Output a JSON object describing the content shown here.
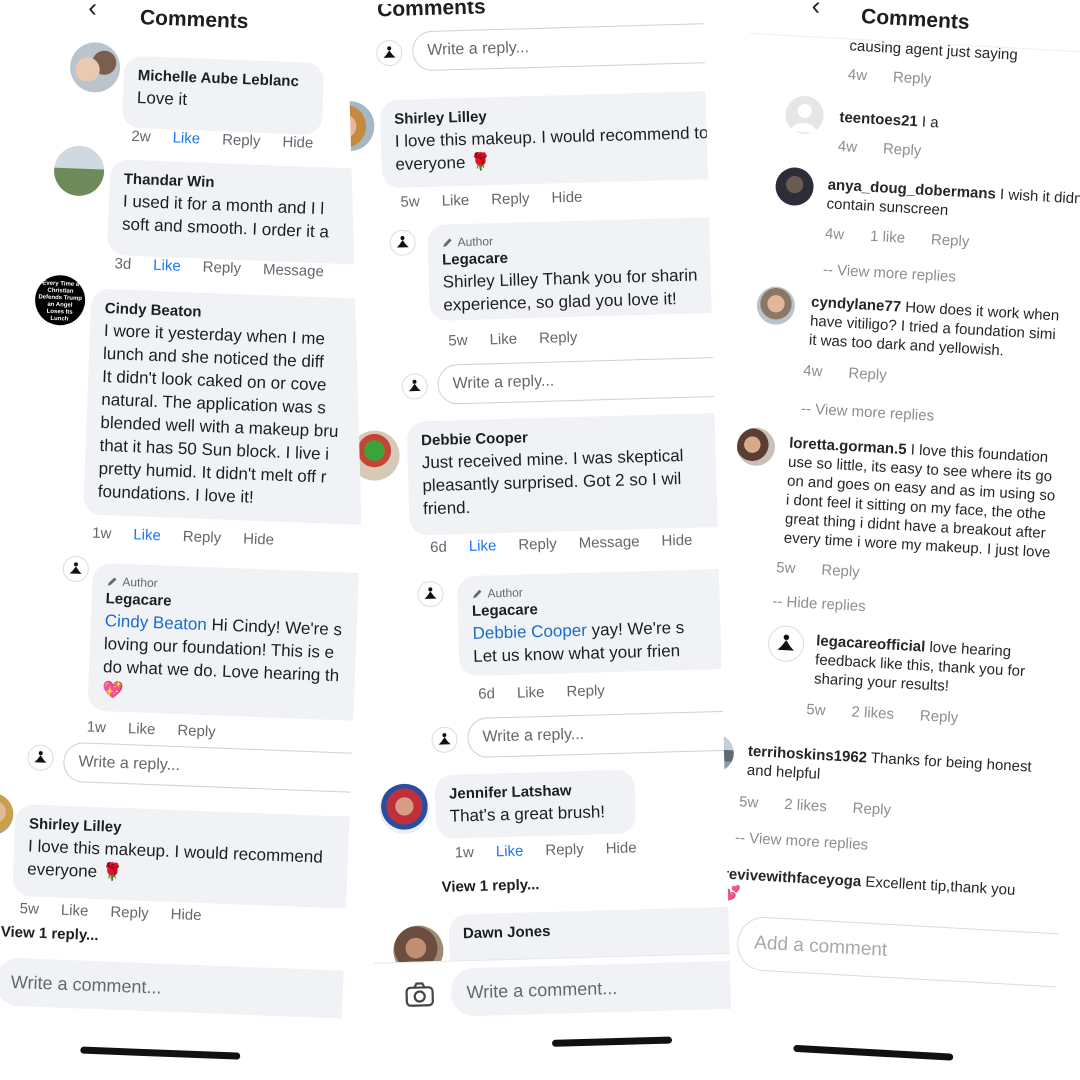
{
  "colors": {
    "like_active": "#1877f2",
    "mention": "#1a6ec8",
    "bubble": "#f0f2f5",
    "meta": "#65676b"
  },
  "icons": {
    "back": "chevron-left-icon",
    "meditation": "meditation-logo-icon",
    "camera": "camera-icon",
    "pencil": "pencil-icon",
    "rose": "rose-emoji",
    "heart": "heart-emoji"
  },
  "p1": {
    "title": "Comments",
    "c1": {
      "name": "Michelle Aube Leblanc",
      "text": "Love it",
      "actions": [
        "2w",
        "Like",
        "Reply",
        "Hide"
      ]
    },
    "c2": {
      "name": "Thandar Win",
      "line1": "I used it for a month and I l",
      "line2": "soft and smooth. I order it a",
      "actions": [
        "3d",
        "Like",
        "Reply",
        "Message"
      ]
    },
    "c3": {
      "avatar_text": "Every Time a Christian Defends Trump an Angel Loses Its Lunch",
      "name": "Cindy Beaton",
      "lines": [
        "I wore it yesterday when I me",
        "lunch and she noticed the diff",
        "It didn't look caked on or cove",
        "natural.  The application was s",
        "blended well with a makeup bru",
        "that it has 50 Sun block.  I live i",
        "pretty humid.  It didn't melt off r",
        "foundations. I love it!"
      ],
      "actions": [
        "1w",
        "Like",
        "Reply",
        "Hide"
      ]
    },
    "r3": {
      "author_label": "Author",
      "name": "Legacare",
      "mention": "Cindy Beaton",
      "line1_rest": " Hi Cindy! We're s",
      "line2": "loving our foundation! This is e",
      "line3": "do what we do. Love hearing th",
      "actions": [
        "1w",
        "Like",
        "Reply"
      ]
    },
    "reply_placeholder": "Write a reply...",
    "c4": {
      "name": "Shirley Lilley",
      "line1": "I love this makeup. I would recommend",
      "line2": "everyone",
      "actions": [
        "5w",
        "Like",
        "Reply",
        "Hide"
      ]
    },
    "view_replies": "View 1 reply...",
    "comment_placeholder": "Write a comment..."
  },
  "p2": {
    "title": "Comments",
    "reply_placeholder": "Write a reply...",
    "c1": {
      "name": "Shirley Lilley",
      "line1": "I love this makeup. I would recommend to",
      "line2": "everyone",
      "actions": [
        "5w",
        "Like",
        "Reply",
        "Hide"
      ]
    },
    "r1": {
      "author_label": "Author",
      "name": "Legacare",
      "line1": "Shirley Lilley Thank you for sharin",
      "line2": "experience, so glad you love it!",
      "actions": [
        "5w",
        "Like",
        "Reply"
      ]
    },
    "c2": {
      "name": "Debbie Cooper",
      "line1": "Just received mine. I was skeptical",
      "line2": "pleasantly surprised. Got 2 so I wil",
      "line3": "friend.",
      "actions": [
        "6d",
        "Like",
        "Reply",
        "Message",
        "Hide"
      ]
    },
    "r2": {
      "author_label": "Author",
      "name": "Legacare",
      "mention": "Debbie Cooper",
      "line1_rest": " yay! We're s",
      "line2": "Let us know what your frien",
      "actions": [
        "6d",
        "Like",
        "Reply"
      ]
    },
    "c3": {
      "name": "Jennifer Latshaw",
      "text": "That's a great brush!",
      "actions": [
        "1w",
        "Like",
        "Reply",
        "Hide"
      ]
    },
    "view_replies": "View 1 reply...",
    "c4": {
      "name": "Dawn Jones"
    },
    "comment_placeholder": "Write a comment..."
  },
  "p3": {
    "title": "Comments",
    "top_text": "causing agent just saying",
    "top_actions": [
      "4w",
      "Reply"
    ],
    "c1": {
      "user": "teentoes21",
      "text": " I a",
      "actions": [
        "4w",
        "Reply"
      ]
    },
    "c2": {
      "user": "anya_doug_dobermans",
      "text": " I wish it didn",
      "line2": "contain sunscreen",
      "actions": [
        "4w",
        "1 like",
        "Reply"
      ]
    },
    "more1": "-- View more replies",
    "c3": {
      "user": "cyndylane77",
      "text": " How does it work when",
      "line2": "have vitiligo?  I tried a foundation simi",
      "line3": "it was too dark and yellowish.",
      "actions": [
        "4w",
        "Reply"
      ]
    },
    "more2": "-- View more replies",
    "c4": {
      "user": "loretta.gorman.5",
      "text": " I love this foundation",
      "lines": [
        "use so little, its easy to see where its go",
        "on and goes on easy and as im using so",
        "i dont feel it sitting on my face, the othe",
        "great thing i didnt have a breakout after",
        "every time i wore my makeup. I just love"
      ],
      "actions": [
        "5w",
        "Reply"
      ]
    },
    "hide_replies": "-- Hide replies",
    "r4": {
      "user": "legacareofficial",
      "text": " love hearing",
      "line2": "feedback like this, thank you for",
      "line3": "sharing your results!",
      "actions": [
        "5w",
        "2 likes",
        "Reply"
      ]
    },
    "c5": {
      "user": "terrihoskins1962",
      "text": " Thanks for being honest",
      "line2": "and helpful",
      "actions": [
        "5w",
        "2 likes",
        "Reply"
      ]
    },
    "more3": "-- View more replies",
    "c6": {
      "user": "revivewithfaceyoga",
      "text": " Excellent tip,thank you"
    },
    "add_placeholder": "Add a comment"
  }
}
